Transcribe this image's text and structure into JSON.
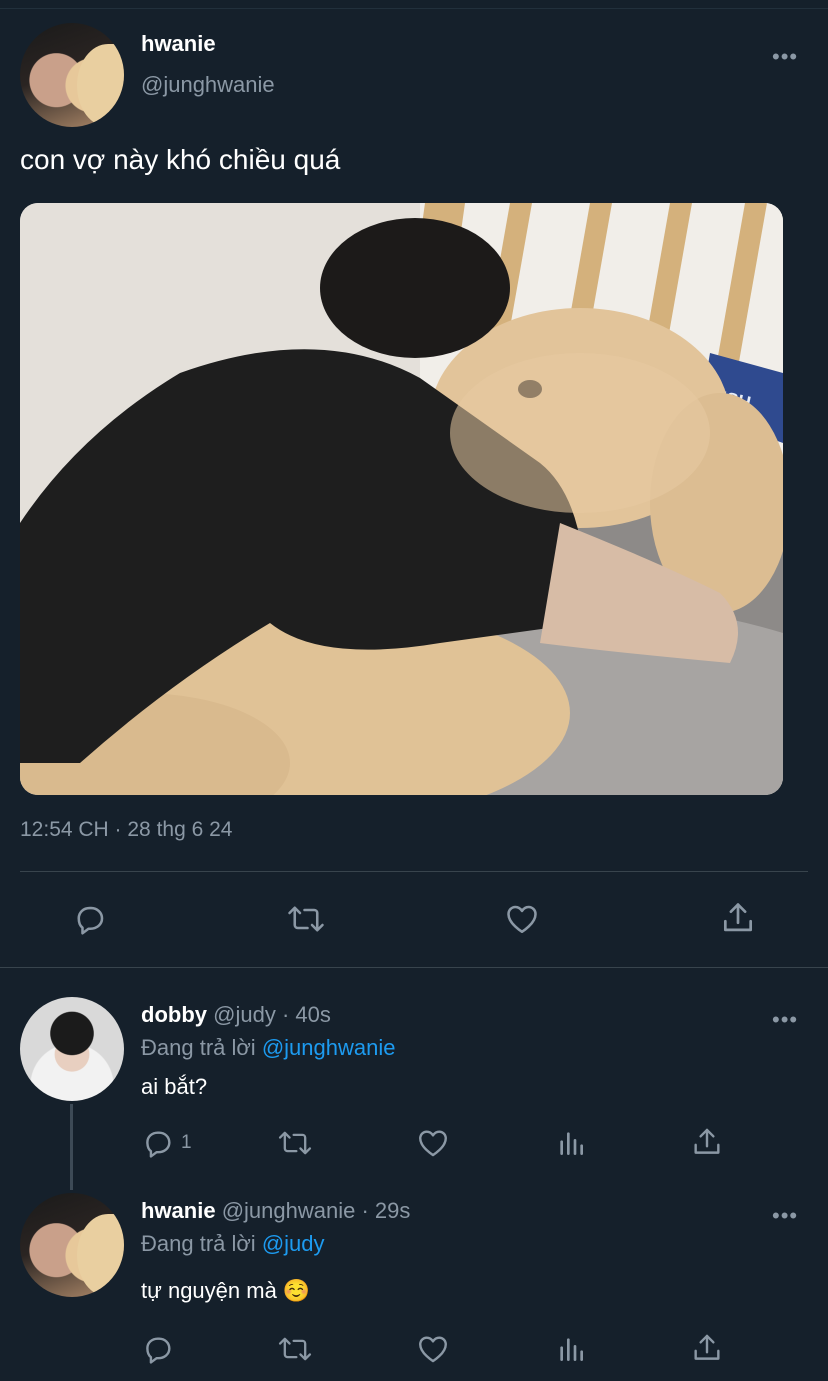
{
  "main_tweet": {
    "name": "hwanie",
    "handle": "@junghwanie",
    "text": "con vợ này khó chiều quá",
    "timestamp": "12:54 CH · 28 thg 6 24",
    "photo_text": "ISH"
  },
  "replies": [
    {
      "name": "dobby",
      "handle": "@judy",
      "time": "· 40s",
      "replying_prefix": "Đang trả lời",
      "replying_to": "@junghwanie",
      "text": "ai bắt?",
      "reply_count": "1"
    },
    {
      "name": "hwanie",
      "handle": "@junghwanie",
      "time": "· 29s",
      "replying_prefix": "Đang trả lời",
      "replying_to": "@judy",
      "text": "tự nguyện mà ☺️",
      "reply_count": ""
    }
  ],
  "icons": {
    "more": "•••",
    "reply": "reply-icon",
    "retweet": "retweet-icon",
    "like": "heart-icon",
    "analytics": "analytics-icon",
    "share": "share-icon"
  },
  "colors": {
    "background": "#15202b",
    "secondary_text": "#8b98a5",
    "link": "#1d9bf0",
    "divider": "#38444d"
  }
}
